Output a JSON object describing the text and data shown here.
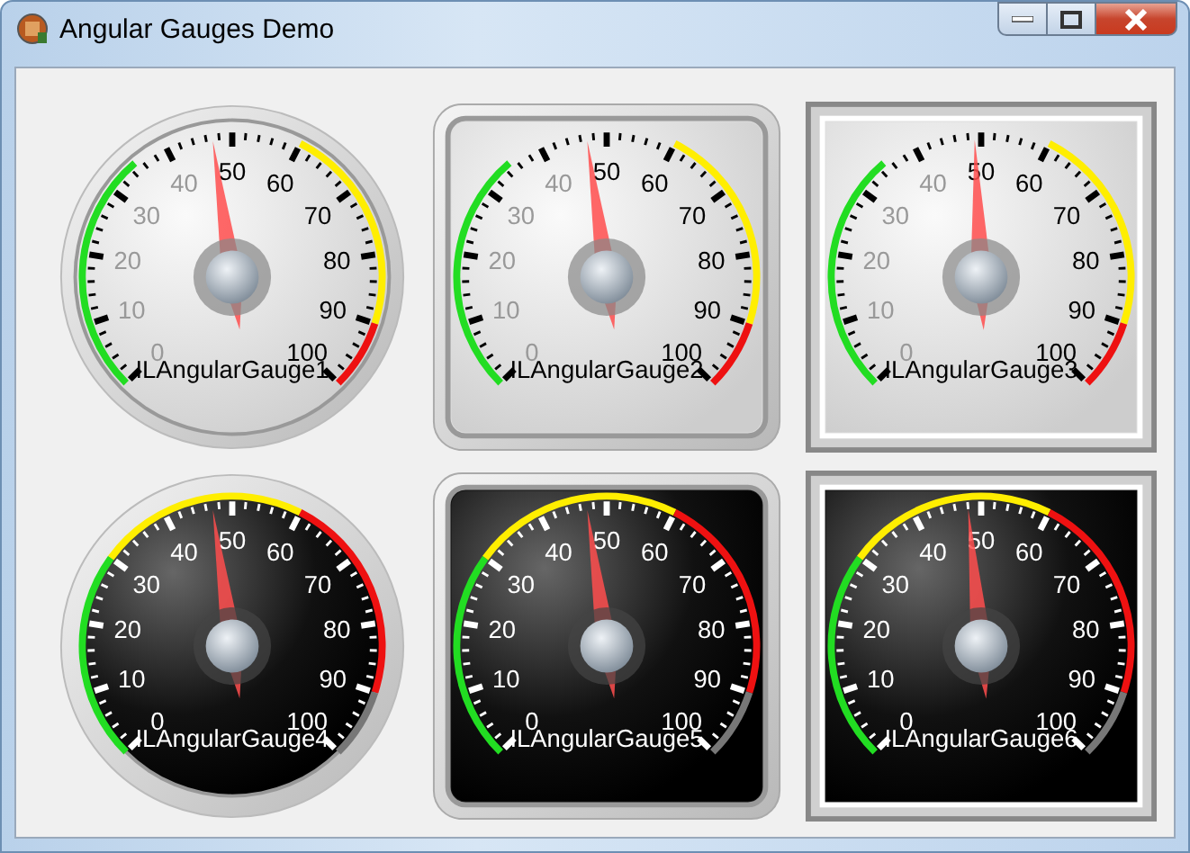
{
  "window": {
    "title": "Angular Gauges Demo"
  },
  "gauges": [
    {
      "label": "ILAngularGauge1",
      "kind": "light_round",
      "level": 0.47,
      "scale_labels": [
        "0",
        "10",
        "20",
        "30",
        "40",
        "50",
        "60",
        "70",
        "80",
        "90",
        "100"
      ]
    },
    {
      "label": "ILAngularGauge2",
      "kind": "light_rounded",
      "level": 0.47,
      "scale_labels": [
        "0",
        "10",
        "20",
        "30",
        "40",
        "50",
        "60",
        "70",
        "80",
        "90",
        "100"
      ]
    },
    {
      "label": "ILAngularGauge3",
      "kind": "light_square",
      "level": 0.49,
      "scale_labels": [
        "0",
        "10",
        "20",
        "30",
        "40",
        "50",
        "60",
        "70",
        "80",
        "90",
        "100"
      ]
    },
    {
      "label": "ILAngularGauge4",
      "kind": "dark_round",
      "level": 0.47,
      "scale_labels": [
        "0",
        "10",
        "20",
        "30",
        "40",
        "50",
        "60",
        "70",
        "80",
        "90",
        "100"
      ]
    },
    {
      "label": "ILAngularGauge5",
      "kind": "dark_rounded",
      "level": 0.47,
      "scale_labels": [
        "0",
        "10",
        "20",
        "30",
        "40",
        "50",
        "60",
        "70",
        "80",
        "90",
        "100"
      ]
    },
    {
      "label": "ILAngularGauge6",
      "kind": "dark_square",
      "level": 0.48,
      "scale_labels": [
        "0",
        "10",
        "20",
        "30",
        "40",
        "50",
        "60",
        "70",
        "80",
        "90",
        "100"
      ]
    }
  ]
}
